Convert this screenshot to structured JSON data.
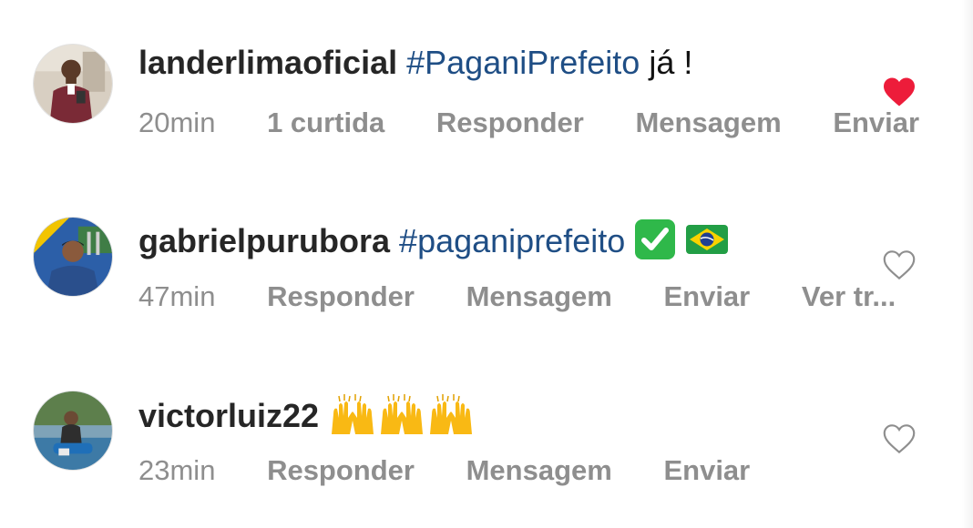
{
  "comments": [
    {
      "username": "landerlimaoficial",
      "hashtag": "#PaganiPrefeito",
      "text": "já !",
      "time": "20min",
      "likes": "1 curtida",
      "actions": [
        "Responder",
        "Mensagem",
        "Enviar"
      ],
      "liked": true
    },
    {
      "username": "gabrielpurubora",
      "hashtag": "#paganiprefeito",
      "emojis": [
        "check-mark-button-emoji",
        "brazil-flag-emoji"
      ],
      "time": "47min",
      "actions": [
        "Responder",
        "Mensagem",
        "Enviar",
        "Ver tr..."
      ],
      "liked": false
    },
    {
      "username": "victorluiz22",
      "emojis": [
        "raising-hands-emoji",
        "raising-hands-emoji",
        "raising-hands-emoji"
      ],
      "time": "23min",
      "actions": [
        "Responder",
        "Mensagem",
        "Enviar"
      ],
      "liked": false
    }
  ],
  "colors": {
    "hashtag": "#1f4e85",
    "meta": "#8e8e8e",
    "liked_heart": "#ed1c3a",
    "checkmark": "#2fb84a"
  }
}
